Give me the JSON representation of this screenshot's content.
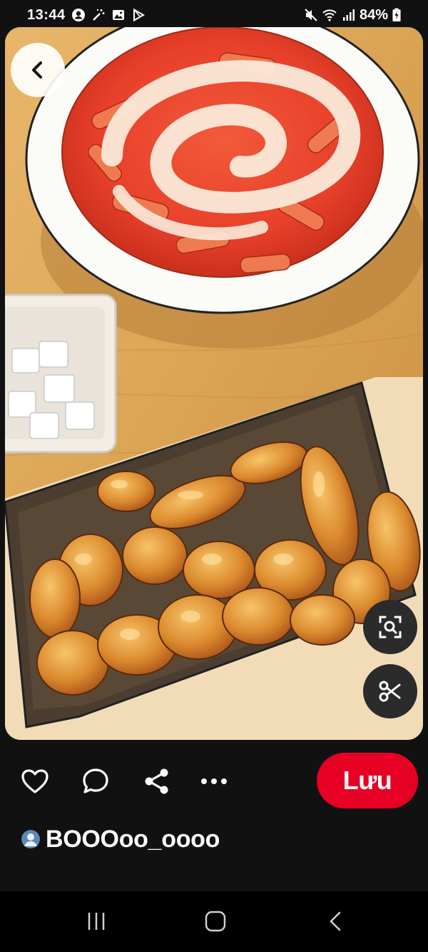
{
  "status_bar": {
    "time": "13:44",
    "battery": "84%",
    "icons_left": [
      "profile-circle-icon",
      "magic-wand-icon",
      "gallery-icon",
      "play-store-icon"
    ],
    "icons_right": [
      "mute-icon",
      "wifi-icon",
      "signal-icon",
      "battery-icon"
    ]
  },
  "pin": {
    "image_subject": "illustration-fried-chicken-tteokbokki",
    "actions": [
      "heart-icon",
      "comment-icon",
      "share-icon",
      "more-icon"
    ],
    "save_label": "Lưu",
    "author": {
      "username": "BOOOoo_oooo",
      "avatar_icon": "avatar-icon"
    }
  },
  "nav_bar": [
    "recents-icon",
    "home-icon",
    "back-icon"
  ],
  "colors": {
    "save": "#e60023",
    "background": "#111111",
    "fab": "#2b2b2b"
  }
}
